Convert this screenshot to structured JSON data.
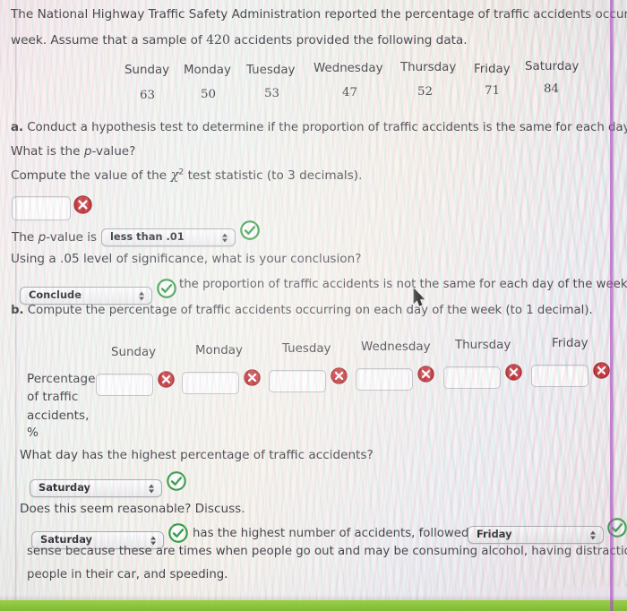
{
  "problem": {
    "intro_line1": "The National Highway Traffic Safety Administration reported the percentage of traffic accidents occurring",
    "intro_line2_pre": "week. Assume that a sample of ",
    "intro_sample_size": "420",
    "intro_line2_post": " accidents provided the following data."
  },
  "data_table": {
    "days": [
      "Sunday",
      "Monday",
      "Tuesday",
      "Wednesday",
      "Thursday",
      "Friday",
      "Saturday"
    ],
    "counts": [
      "63",
      "50",
      "53",
      "47",
      "52",
      "71",
      "84"
    ]
  },
  "part_a": {
    "label": "a.",
    "prompt": " Conduct a hypothesis test to determine if the proportion of traffic accidents is the same for each day o",
    "pvalue_question": "What is the p-value?",
    "chi_prompt_pre": "Compute the value of the ",
    "chi_symbol": "χ",
    "chi_exponent": "2",
    "chi_prompt_post": " test statistic (to 3 decimals).",
    "chi_input_value": "",
    "chi_input_status": "incorrect",
    "pvalue_label_pre": "The ",
    "pvalue_label_italic": "p",
    "pvalue_label_post": "-value is",
    "pvalue_select_value": "less than .01",
    "pvalue_status": "correct",
    "significance_question": "Using a .05 level of significance, what is your conclusion?",
    "conclusion_select_value": "Conclude",
    "conclusion_status": "correct",
    "conclusion_text": "the proportion of traffic accidents is not the same for each day of the week."
  },
  "part_b": {
    "label": "b.",
    "prompt": " Compute the percentage of traffic accidents occurring on each day of the week (to 1 decimal).",
    "days": [
      "Sunday",
      "Monday",
      "Tuesday",
      "Wednesday",
      "Thursday",
      "Friday"
    ],
    "row_label_lines": [
      "Percentage",
      "of traffic",
      "accidents,",
      "%"
    ],
    "inputs": [
      "",
      "",
      "",
      "",
      "",
      ""
    ],
    "input_statuses": [
      "incorrect",
      "incorrect",
      "incorrect",
      "incorrect",
      "incorrect",
      "incorrect"
    ],
    "highest_question": "What day has the highest percentage of traffic accidents?",
    "highest_select_value": "Saturday",
    "highest_status": "correct",
    "reasonable_question": "Does this seem reasonable? Discuss.",
    "reason_select_value": "Saturday",
    "reason_status": "correct",
    "reason_text_mid": "has the highest number of accidents, followed by",
    "reason_select2_value": "Friday",
    "reason_status2": "correct",
    "reason_line2": "sense because these are times when people go out and may be consuming alcohol, having distractions su",
    "reason_line3": "people in their car, and speeding."
  },
  "icons": {
    "incorrect_name": "incorrect-x-icon",
    "correct_name": "correct-check-icon",
    "dropdown_name": "select-stepper-arrows-icon",
    "cursor_name": "mouse-pointer-cursor"
  },
  "colors": {
    "incorrect_red": "#c1272d",
    "correct_green": "#2e9b3e",
    "text": "#3c3c42",
    "page_background": "#f3f1ef",
    "screen_edge_purple": "#8c3caa",
    "bottom_band_green": "#78b92d"
  }
}
